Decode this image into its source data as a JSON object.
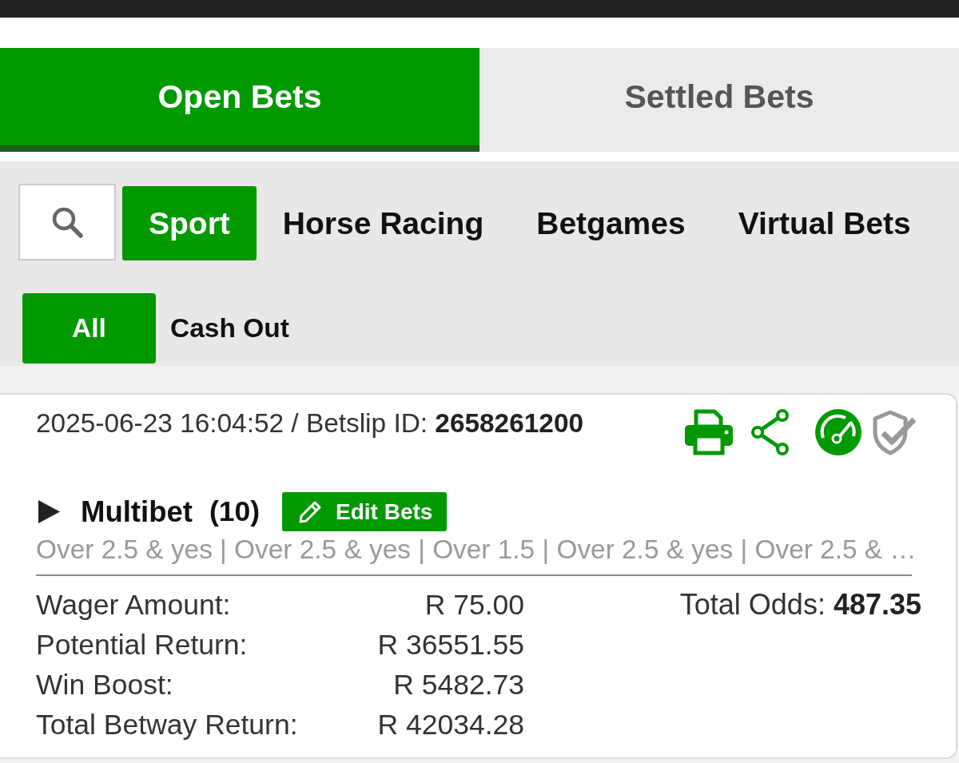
{
  "tabs": [
    {
      "label": "Open Bets",
      "selected": true
    },
    {
      "label": "Settled Bets",
      "selected": false
    }
  ],
  "categories": [
    {
      "label": "Sport",
      "selected": true
    },
    {
      "label": "Horse Racing",
      "selected": false
    },
    {
      "label": "Betgames",
      "selected": false
    },
    {
      "label": "Virtual Bets",
      "selected": false
    }
  ],
  "filters": [
    {
      "label": "All",
      "selected": true
    },
    {
      "label": "Cash Out",
      "selected": false
    }
  ],
  "bet": {
    "header": "2025-06-23 16:04:52 / Betslip ID: **2658261200**",
    "expanded": false,
    "type": "Multibet",
    "count": "(10)",
    "edit_button": "Edit Bets",
    "selections": "Over 2.5 & yes | Over 2.5 & yes | Over 1.5 | Over 2.5 & yes | Over 2.5 & …",
    "amounts": [
      {
        "label": "Wager Amount:",
        "value": "R 75.00"
      },
      {
        "label": "Potential Return:",
        "value": "R 36551.55"
      },
      {
        "label": "Win Boost:",
        "value": "R 5482.73"
      },
      {
        "label": "Total Betway Return:",
        "value": "R 42034.28"
      }
    ],
    "total_odds": "Total Odds: **487.35**"
  }
}
